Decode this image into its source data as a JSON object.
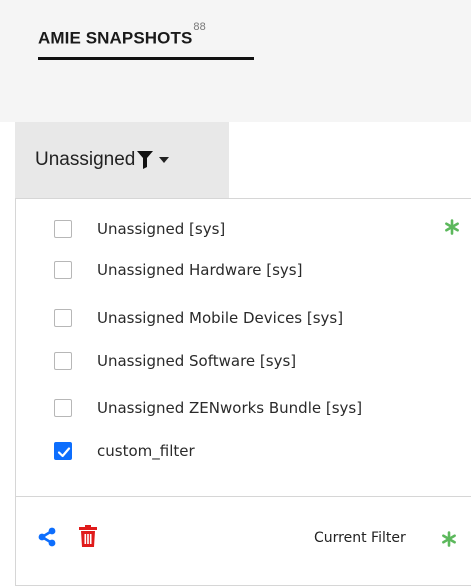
{
  "header": {
    "title": "AMIE SNAPSHOTS",
    "count": "88"
  },
  "filter": {
    "selected_label": "Unassigned",
    "icon": "filter-funnel-icon"
  },
  "dropdown": {
    "items": [
      {
        "label": "Unassigned [sys]",
        "checked": false,
        "is_current": true
      },
      {
        "label": "Unassigned Hardware [sys]",
        "checked": false,
        "is_current": false
      },
      {
        "label": "Unassigned Mobile Devices [sys]",
        "checked": false,
        "is_current": false
      },
      {
        "label": "Unassigned Software [sys]",
        "checked": false,
        "is_current": false
      },
      {
        "label": "Unassigned ZENworks Bundle [sys]",
        "checked": false,
        "is_current": false
      },
      {
        "label": "custom_filter",
        "checked": true,
        "is_current": false
      }
    ],
    "footer": {
      "current_filter_label": "Current Filter",
      "share_icon": "share-icon",
      "delete_icon": "trash-icon"
    }
  },
  "colors": {
    "accent_blue": "#0d6efd",
    "delete_red": "#e01b1b",
    "current_marker_green": "#5cb85c",
    "header_bg": "#f5f5f5",
    "toggle_bg": "#e8e8e8"
  }
}
